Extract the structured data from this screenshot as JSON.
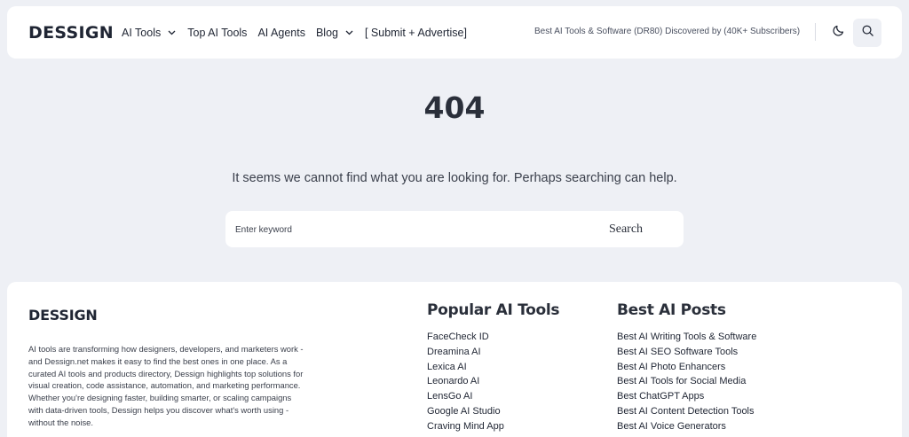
{
  "header": {
    "logo": "DESSIGN",
    "nav": [
      {
        "label": "AI Tools",
        "dropdown": true
      },
      {
        "label": "Top AI Tools",
        "dropdown": false
      },
      {
        "label": "AI Agents",
        "dropdown": false
      },
      {
        "label": "Blog",
        "dropdown": true
      },
      {
        "label": "[ Submit + Advertise]",
        "dropdown": false
      }
    ],
    "tagline": "Best AI Tools & Software (DR80) Discovered by (40K+ Subscribers)",
    "icons": {
      "theme": "moon-icon",
      "search": "search-icon"
    }
  },
  "main": {
    "code": "404",
    "message": "It seems we cannot find what you are looking for. Perhaps searching can help.",
    "search": {
      "placeholder": "Enter keyword",
      "value": "",
      "button": "Search"
    }
  },
  "footer": {
    "logo": "DESSIGN",
    "description": "AI tools are transforming how designers, developers, and marketers work - and Dessign.net makes it easy to find the best ones in one place. As a curated AI tools and products directory, Dessign highlights top solutions for visual creation, code assistance, automation, and marketing performance. Whether you're designing faster, building smarter, or scaling campaigns with data-driven tools, Dessign helps you discover what's worth using - without the noise.",
    "popular": {
      "title": "Popular AI Tools",
      "items": [
        "FaceCheck ID",
        "Dreamina AI",
        "Lexica AI",
        "Leonardo AI",
        "LensGo AI",
        "Google AI Studio",
        "Craving Mind App"
      ]
    },
    "posts": {
      "title": "Best AI Posts",
      "items": [
        "Best AI Writing Tools & Software",
        "Best AI SEO Software Tools",
        "Best AI Photo Enhancers",
        "Best AI Tools for Social Media",
        "Best ChatGPT Apps",
        "Best AI Content Detection Tools",
        "Best AI Voice Generators"
      ]
    }
  },
  "colors": {
    "background": "#eef0f5",
    "surface": "#ffffff",
    "text": "#1f2533"
  }
}
